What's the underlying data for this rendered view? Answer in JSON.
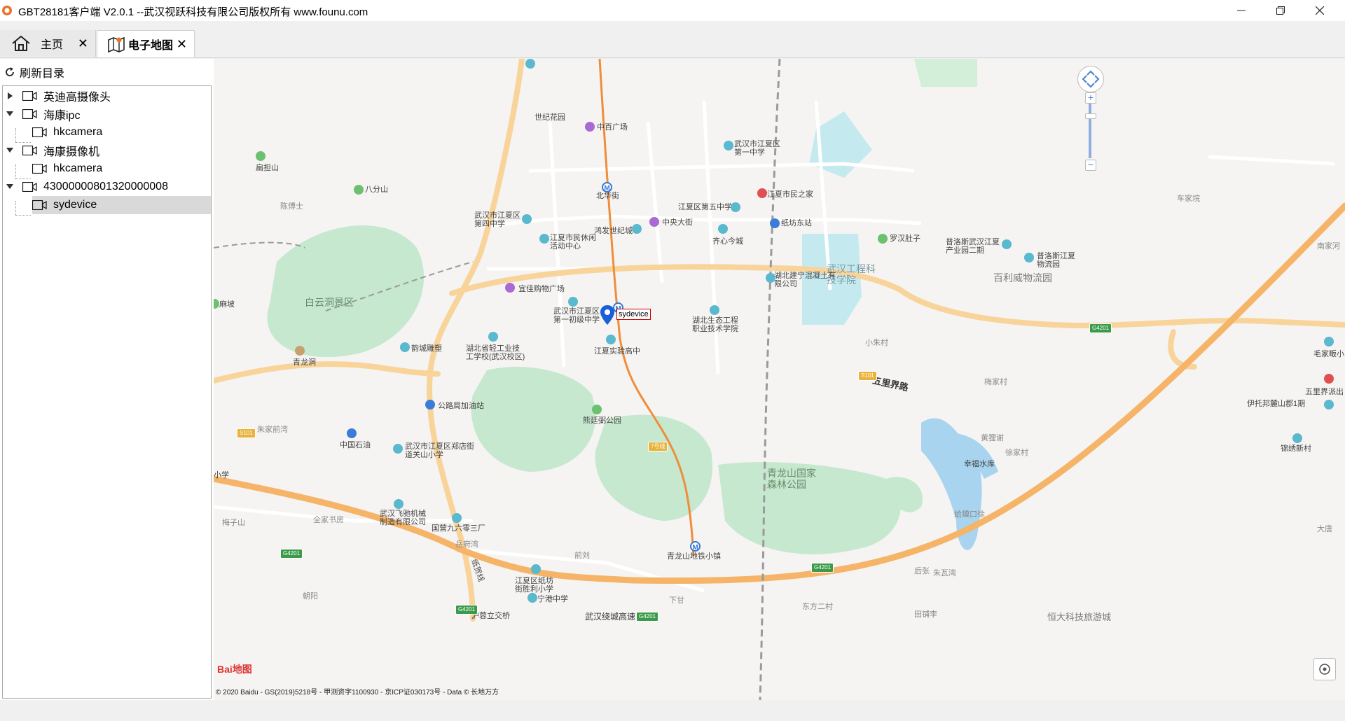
{
  "window": {
    "title": "GBT28181客户端 V2.0.1 --武汉视跃科技有限公司版权所有 www.founu.com",
    "minimize_icon": "minimize-icon",
    "maximize_icon": "restore-icon",
    "close_icon": "close-icon"
  },
  "tabs": [
    {
      "label": "主页",
      "icon": "home-icon"
    },
    {
      "label": "电子地图",
      "icon": "map-icon"
    }
  ],
  "sidebar": {
    "refresh_label": "刷新目录",
    "tree": [
      {
        "label": "英迪高摄像头",
        "expanded": false
      },
      {
        "label": "海康ipc",
        "expanded": true
      },
      {
        "label": "hkcamera"
      },
      {
        "label": "海康摄像机",
        "expanded": true
      },
      {
        "label": "hkcamera"
      },
      {
        "label": "43000000801320000008",
        "expanded": true
      },
      {
        "label": "sydevice",
        "selected": true
      }
    ]
  },
  "map": {
    "marker_label": "sydevice",
    "copyright": "© 2020 Baidu - GS(2019)5218号 - 甲测资字1100930 - 京ICP证030173号 - Data © 长地万方",
    "logo_text": "Bai地图",
    "labels": [
      "世纪花园",
      "中百广场",
      "武汉市江夏区第一中学",
      "扁担山",
      "八分山",
      "北华街",
      "江夏市民之家",
      "陈傅士",
      "武汉市江夏区第四中学",
      "江夏区第五中学",
      "中央大街",
      "纸坊东站",
      "车家垸",
      "鸿发世纪城",
      "江夏市民休闲活动中心",
      "齐心今城",
      "罗汉肚子",
      "普洛斯武汉江夏产业园二期",
      "普洛斯江夏物流园",
      "南家河",
      "武汉工程科技学院",
      "湖北建宁混凝土有限公司",
      "百利威物流园",
      "麻坡",
      "白云洞景区",
      "宜佳购物广场",
      "武汉市江夏区第一初级中学",
      "湖北生态工程职业技术学院",
      "青龙洞",
      "韵城雕塑",
      "湖北省轻工业技工学校(武汉校区)",
      "江夏实验高中",
      "小朱村",
      "毛家畈小",
      "五里界路",
      "梅家村",
      "五里界派出",
      "公路局加油站",
      "熊廷弼公园",
      "伊托邦麓山郡1期",
      "朱家前湾",
      "中国石油",
      "武汉市江夏区郑店街道关山小学",
      "黄狸谢",
      "锦绣新村",
      "青龙山国家森林公园",
      "幸福水库",
      "徐家村",
      "小学",
      "武汉飞驰机械制造有限公司",
      "国营九六零三厂",
      "全家书房",
      "梅子山",
      "蛤蟆口徐",
      "大唐",
      "岳府湾",
      "前刘",
      "青龙山地铁小镇",
      "后张",
      "朱瓦湾",
      "江夏区纸坊街胜利小学",
      "宁港中学",
      "朝阳",
      "下甘",
      "东方二村",
      "田铺李",
      "恒大科技旅游城",
      "沪蓉立交桥",
      "武汉绕城高速",
      "纸贺线",
      "7号线"
    ]
  }
}
